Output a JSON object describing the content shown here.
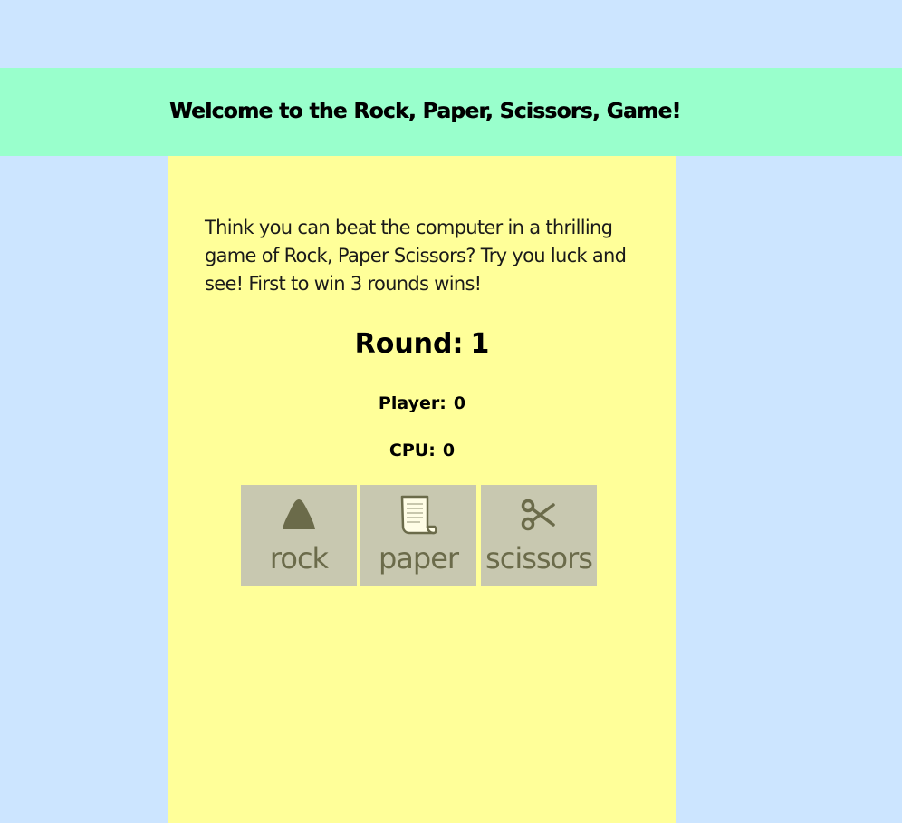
{
  "header": {
    "title": "Welcome to the Rock, Paper, Scissors, Game!"
  },
  "intro": {
    "text": "Think you can beat the computer in a thrilling game of Rock, Paper Scissors? Try you luck and see! First to win 3 rounds wins!"
  },
  "round": {
    "label": "Round:",
    "value": "1"
  },
  "scores": {
    "player_label": "Player:",
    "player_value": "0",
    "cpu_label": "CPU:",
    "cpu_value": "0"
  },
  "choices": [
    {
      "label": "rock",
      "icon": "rock-icon"
    },
    {
      "label": "paper",
      "icon": "paper-icon"
    },
    {
      "label": "scissors",
      "icon": "scissors-icon"
    }
  ],
  "colors": {
    "page_background": "#cce5ff",
    "header_background": "#99ffcc",
    "panel_background": "#ffff99",
    "button_background": "#c8c8b0",
    "button_foreground": "#6b6b4a"
  }
}
